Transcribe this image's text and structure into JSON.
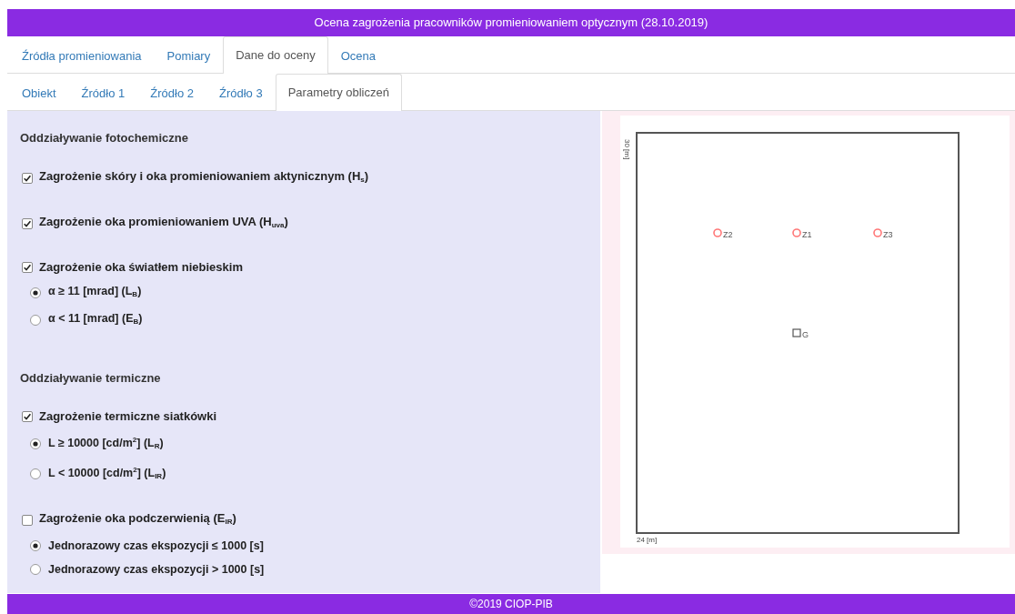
{
  "window": {
    "title": "Ocena zagrożenia pracowników promieniowaniem optycznym (28.10.2019)"
  },
  "tabs": [
    {
      "label": "Źródła promieniowania",
      "selected": false
    },
    {
      "label": "Pomiary",
      "selected": false
    },
    {
      "label": "Dane do oceny",
      "selected": true
    },
    {
      "label": "Ocena",
      "selected": false
    }
  ],
  "subtabs": [
    {
      "label": "Obiekt",
      "selected": false
    },
    {
      "label": "Źródło 1",
      "selected": false
    },
    {
      "label": "Źródło 2",
      "selected": false
    },
    {
      "label": "Źródło 3",
      "selected": false
    },
    {
      "label": "Parametry obliczeń",
      "selected": true
    }
  ],
  "sections": [
    {
      "heading": "Oddziaływanie fotochemiczne",
      "options": [
        {
          "label": "Zagrożenie skóry i oka promieniowaniem aktynicznym (H$_{s}$)",
          "checked": true
        },
        {
          "label": "Zagrożenie oka promieniowaniem UVA (H$_{uva}$)",
          "checked": true
        },
        {
          "label": "Zagrożenie oka światłem niebieskim",
          "checked": true,
          "choices": [
            {
              "label": "α ≥ 11 [mrad] (L$_{B}$)",
              "selected": true
            },
            {
              "label": "α < 11 [mrad] (E$_{B}$)",
              "selected": false
            }
          ]
        }
      ]
    },
    {
      "heading": "Oddziaływanie termiczne",
      "options": [
        {
          "label": "Zagrożenie termiczne siatkówki",
          "checked": true,
          "choices": [
            {
              "label": "L ≥ 10000 [cd/m$^{2}$] (L$_{R}$)",
              "selected": true
            },
            {
              "label": "L < 10000 [cd/m$^{2}$] (L$_{IR}$)",
              "selected": false
            }
          ]
        },
        {
          "label": "Zagrożenie oka podczerwienią (E$_{IR}$)",
          "checked": false,
          "choices": [
            {
              "label": "Jednorazowy czas ekspozycji ≤ 1000 [s]",
              "selected": true
            },
            {
              "label": "Jednorazowy czas ekspozycji > 1000 [s]",
              "selected": false
            }
          ]
        }
      ]
    }
  ],
  "site_plan": {
    "y_label": "30 [m]",
    "x_label": "24 [m]",
    "points": [
      {
        "kind": "source",
        "label": "Z2"
      },
      {
        "kind": "source",
        "label": "Z1"
      },
      {
        "kind": "source",
        "label": "Z3"
      },
      {
        "kind": "reference",
        "label": "G"
      }
    ]
  },
  "footer": "©2019 CIOP-PIB"
}
